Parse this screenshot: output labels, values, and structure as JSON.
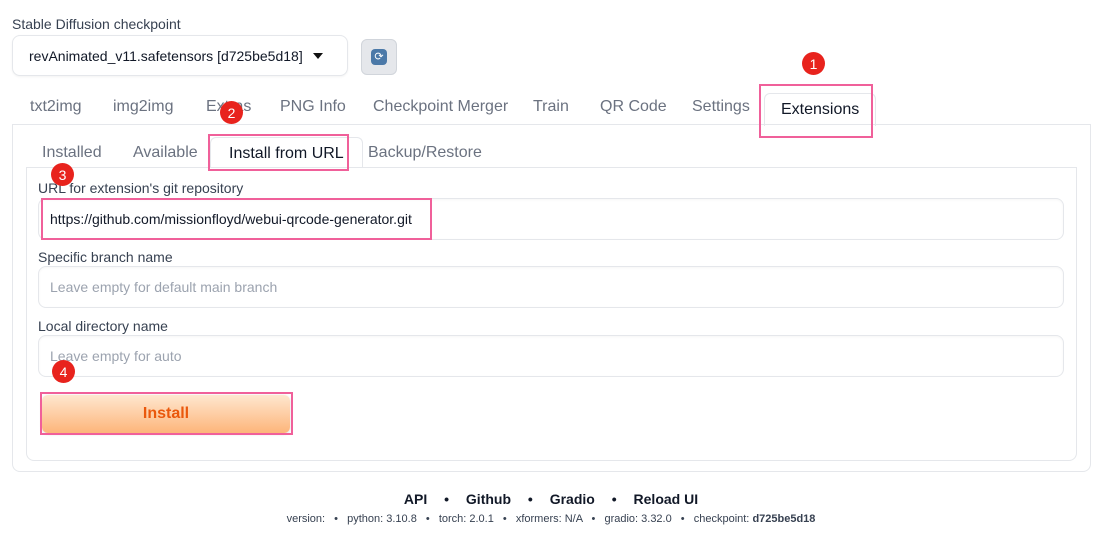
{
  "checkpoint": {
    "label": "Stable Diffusion checkpoint",
    "value": "revAnimated_v11.safetensors [d725be5d18]",
    "refresh_icon": "refresh-icon"
  },
  "tabs": {
    "items": [
      "txt2img",
      "img2img",
      "Extras",
      "PNG Info",
      "Checkpoint Merger",
      "Train",
      "QR Code",
      "Settings",
      "Extensions"
    ],
    "active": "Extensions"
  },
  "subtabs": {
    "items": [
      "Installed",
      "Available",
      "Install from URL",
      "Backup/Restore"
    ],
    "active": "Install from URL"
  },
  "form": {
    "url_label": "URL for extension's git repository",
    "url_value": "https://github.com/missionfloyd/webui-qrcode-generator.git",
    "branch_label": "Specific branch name",
    "branch_placeholder": "Leave empty for default main branch",
    "dir_label": "Local directory name",
    "dir_placeholder": "Leave empty for auto",
    "install_label": "Install"
  },
  "annotations": {
    "step1": "1",
    "step2": "2",
    "step3": "3",
    "step4": "4",
    "highlight_color": "#f0609a",
    "badge_color": "#e8231d"
  },
  "footer": {
    "links": [
      "API",
      "Github",
      "Gradio",
      "Reload UI"
    ],
    "version_label": "version:",
    "python": "python: 3.10.8",
    "torch": "torch: 2.0.1",
    "xformers": "xformers: N/A",
    "gradio": "gradio: 3.32.0",
    "checkpoint_label": "checkpoint:",
    "checkpoint_hash": "d725be5d18"
  }
}
